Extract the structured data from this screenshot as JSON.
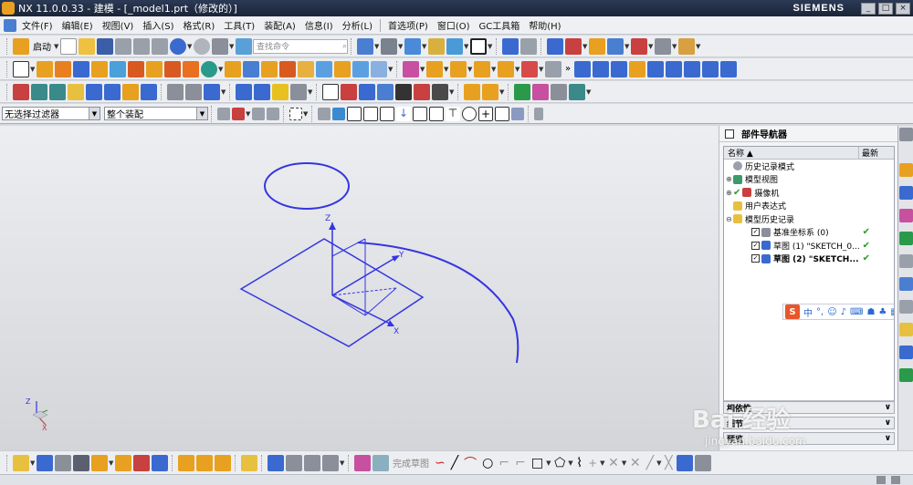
{
  "window": {
    "title": "NX 11.0.0.33 - 建模 - [_model1.prt（修改的）]",
    "brand": "SIEMENS"
  },
  "menu": {
    "items": [
      "文件(F)",
      "编辑(E)",
      "视图(V)",
      "插入(S)",
      "格式(R)",
      "工具(T)",
      "装配(A)",
      "信息(I)",
      "分析(L)",
      "首选项(P)",
      "窗口(O)",
      "GC工具箱",
      "帮助(H)"
    ]
  },
  "toolbar1": {
    "start_label": "启动",
    "search_placeholder": "查找命令"
  },
  "filterbar": {
    "filter_value": "无选择过滤器",
    "scope_value": "整个装配"
  },
  "navigator": {
    "title": "部件导航器",
    "col_name": "名称",
    "col_latest": "最新",
    "rows": [
      {
        "label": "历史记录模式",
        "indent": 0
      },
      {
        "label": "模型视图",
        "indent": 0
      },
      {
        "label": "摄像机",
        "indent": 0
      },
      {
        "label": "用户表达式",
        "indent": 0
      },
      {
        "label": "模型历史记录",
        "indent": 0
      },
      {
        "label": "基准坐标系 (0)",
        "indent": 1,
        "latest": "✔"
      },
      {
        "label": "草图 (1) \"SKETCH_0...",
        "indent": 1,
        "latest": "✔"
      },
      {
        "label": "草图 (2) \"SKETCH...",
        "indent": 1,
        "latest": "✔"
      }
    ],
    "sections": [
      "相依性",
      "细节",
      "预览"
    ]
  },
  "ime": {
    "lang": "中"
  },
  "bottombar": {
    "finish_sketch": "完成草图"
  },
  "viewport": {
    "axis_z": "Z",
    "axis_y": "Y",
    "axis_x": "X",
    "tri_z": "Z",
    "tri_x": "X"
  },
  "watermark": {
    "text": "Bai 经验",
    "url": "jingyan.baidu.com"
  }
}
